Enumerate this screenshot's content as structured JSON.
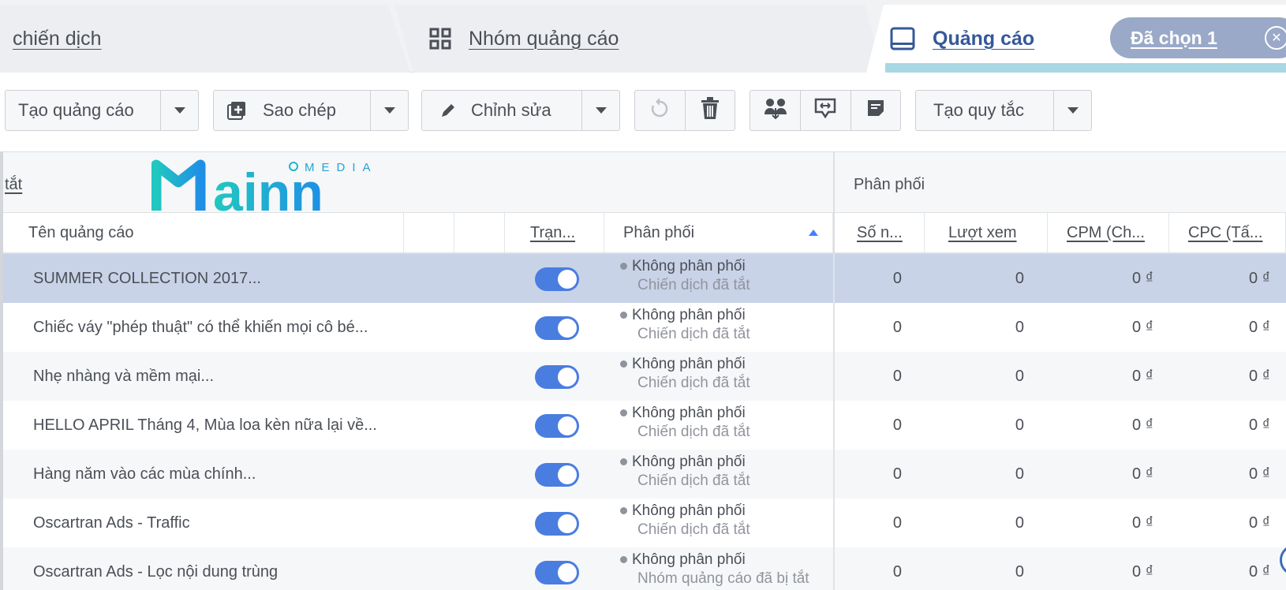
{
  "tabs": {
    "campaign": "chiến dịch",
    "adset": "Nhóm quảng cáo",
    "ad": "Quảng cáo",
    "selected_pill": "Đã chọn 1",
    "pill_close": "✕"
  },
  "toolbar": {
    "create_ad": "Tạo quảng cáo",
    "duplicate": "Sao chép",
    "edit": "Chỉnh sửa",
    "create_rule": "Tạo quy tắc"
  },
  "logo": {
    "text": "Mainn",
    "sub": "MEDIA",
    "colors": [
      "#21c8c0",
      "#1f8fe6"
    ]
  },
  "table": {
    "group_left": "tắt",
    "group_right": "Phân phối",
    "headers": {
      "name": "Tên quảng cáo",
      "status": "Trạn...",
      "delivery": "Phân phối",
      "reach": "Số n...",
      "views": "Lượt xem",
      "cpm": "CPM (Ch...",
      "cpc": "CPC (Tấ..."
    },
    "rows": [
      {
        "name": "SUMMER COLLECTION 2017...",
        "delivery": "Không phân phối",
        "delivery_sub": "Chiến dịch đã tắt",
        "reach": "0",
        "views": "0",
        "cpm": "0 ₫",
        "cpc": "0 ₫"
      },
      {
        "name": "Chiếc váy \"phép thuật\" có thể khiến mọi cô bé...",
        "delivery": "Không phân phối",
        "delivery_sub": "Chiến dịch đã tắt",
        "reach": "0",
        "views": "0",
        "cpm": "0 ₫",
        "cpc": "0 ₫"
      },
      {
        "name": "Nhẹ nhàng và mềm mại...",
        "delivery": "Không phân phối",
        "delivery_sub": "Chiến dịch đã tắt",
        "reach": "0",
        "views": "0",
        "cpm": "0 ₫",
        "cpc": "0 ₫"
      },
      {
        "name": "HELLO APRIL Tháng 4, Mùa loa kèn nữa lại về...",
        "delivery": "Không phân phối",
        "delivery_sub": "Chiến dịch đã tắt",
        "reach": "0",
        "views": "0",
        "cpm": "0 ₫",
        "cpc": "0 ₫"
      },
      {
        "name": "Hàng năm vào các mùa chính...",
        "delivery": "Không phân phối",
        "delivery_sub": "Chiến dịch đã tắt",
        "reach": "0",
        "views": "0",
        "cpm": "0 ₫",
        "cpc": "0 ₫"
      },
      {
        "name": "Oscartran Ads - Traffic",
        "delivery": "Không phân phối",
        "delivery_sub": "Chiến dịch đã tắt",
        "reach": "0",
        "views": "0",
        "cpm": "0 ₫",
        "cpc": "0 ₫"
      },
      {
        "name": "Oscartran Ads - Lọc nội dung trùng",
        "delivery": "Không phân phối",
        "delivery_sub": "Nhóm quảng cáo đã bị tắt",
        "reach": "0",
        "views": "0",
        "cpm": "0 ₫",
        "cpc": "0 ₫"
      }
    ]
  }
}
